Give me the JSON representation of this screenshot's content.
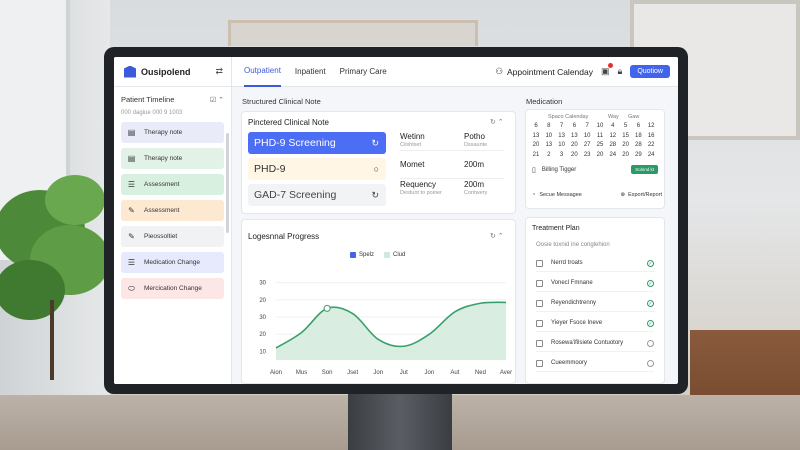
{
  "app": {
    "name": "Ousipolend"
  },
  "tabs": [
    {
      "label": "Outpatient"
    },
    {
      "label": "Inpatient"
    },
    {
      "label": "Primary Care"
    }
  ],
  "topbar": {
    "appointment": "Appointment Calenday",
    "button": "Quotiow"
  },
  "sidebar": {
    "title": "Patient Timeline",
    "subtitle": "000 dagiue 000 9 1003",
    "items": [
      {
        "label": "Therapy note",
        "icon": "document-icon",
        "color": "#e9ebf8"
      },
      {
        "label": "Therapy note",
        "icon": "document-icon",
        "color": "#e3f2e6"
      },
      {
        "label": "Assessment",
        "icon": "list-icon",
        "color": "#d8f0df"
      },
      {
        "label": "Assessment",
        "icon": "pen-icon",
        "color": "#fde9d2"
      },
      {
        "label": "Pieossoltiet",
        "icon": "pen-icon",
        "color": "#f1f2f4"
      },
      {
        "label": "Medication Change",
        "icon": "list-icon",
        "color": "#e6eafc"
      },
      {
        "label": "Mercication Change",
        "icon": "pill-icon",
        "color": "#fde6e6"
      }
    ]
  },
  "structured": {
    "section": "Structured Clinical Note",
    "card_title": "Pinctered Clinical Note",
    "notes": [
      {
        "label": "PHD-9 Screening",
        "status": "↻"
      },
      {
        "label": "PHD-9",
        "status": "○"
      },
      {
        "label": "GAD-7 Screening",
        "status": "↻"
      }
    ],
    "fields": [
      {
        "label": "Wetinn",
        "sub": "Ciishtset",
        "value": "Potho",
        "vsub": "Dssaunte"
      },
      {
        "label": "Momet",
        "sub": "",
        "value": "200m",
        "vsub": ""
      },
      {
        "label": "Requency",
        "sub": "Destuot to poioer",
        "value": "200m",
        "vsub": "Contwery"
      }
    ]
  },
  "progress": {
    "title": "Logesnnal Progress",
    "legend": [
      "Spelz",
      "Clud"
    ]
  },
  "chart_data": {
    "type": "area",
    "title": "Logesnnal Progress",
    "categories": [
      "Aion",
      "Mus",
      "Son",
      "Jset",
      "Jon",
      "Jut",
      "Jon",
      "Aut",
      "Ned",
      "Aver"
    ],
    "series": [
      {
        "name": "Spelz",
        "values": [
          12,
          21,
          35,
          32,
          17,
          13,
          20,
          33,
          38,
          38.5
        ]
      }
    ],
    "yticks": [
      10,
      20,
      30,
      40,
      50
    ],
    "ytick_labels": [
      "10",
      "20",
      "30",
      "20",
      "30"
    ],
    "ylim": [
      5,
      55
    ],
    "legend": "top-center",
    "colors": {
      "line": "#3aa06b",
      "fill": "#cfead9"
    }
  },
  "medication": {
    "section": "Medication",
    "cal_header": [
      "Spaco Calenday",
      "Way",
      "Gaw"
    ],
    "cal_rows": [
      [
        "6",
        "8",
        "7",
        "6",
        "7",
        "10",
        "4",
        "5",
        "6",
        "12"
      ],
      [
        "13",
        "10",
        "13",
        "13",
        "10",
        "11",
        "12",
        "15",
        "18",
        "16"
      ],
      [
        "20",
        "13",
        "10",
        "20",
        "27",
        "25",
        "28",
        "20",
        "28",
        "22"
      ],
      [
        "21",
        "2",
        "3",
        "20",
        "23",
        "20",
        "24",
        "20",
        "29",
        "24"
      ]
    ],
    "billing": "Billing Tigger",
    "billing_badge": "Solnnd kt",
    "secure": "Secue Messagee",
    "export": "Export/Report"
  },
  "treatment": {
    "title": "Treatment Plan",
    "subtitle": "Oosie toxnid ine conglehion",
    "items": [
      {
        "label": "Nerrd troats",
        "done": true
      },
      {
        "label": "Vonecl Fmnane",
        "done": true
      },
      {
        "label": "Reyendichtrenny",
        "done": true
      },
      {
        "label": "Yieyer Fsoce Ineve",
        "done": true
      },
      {
        "label": "Rosewa'ifilsiete Contuotory",
        "done": false
      },
      {
        "label": "Cueemmoory",
        "done": false
      }
    ]
  }
}
